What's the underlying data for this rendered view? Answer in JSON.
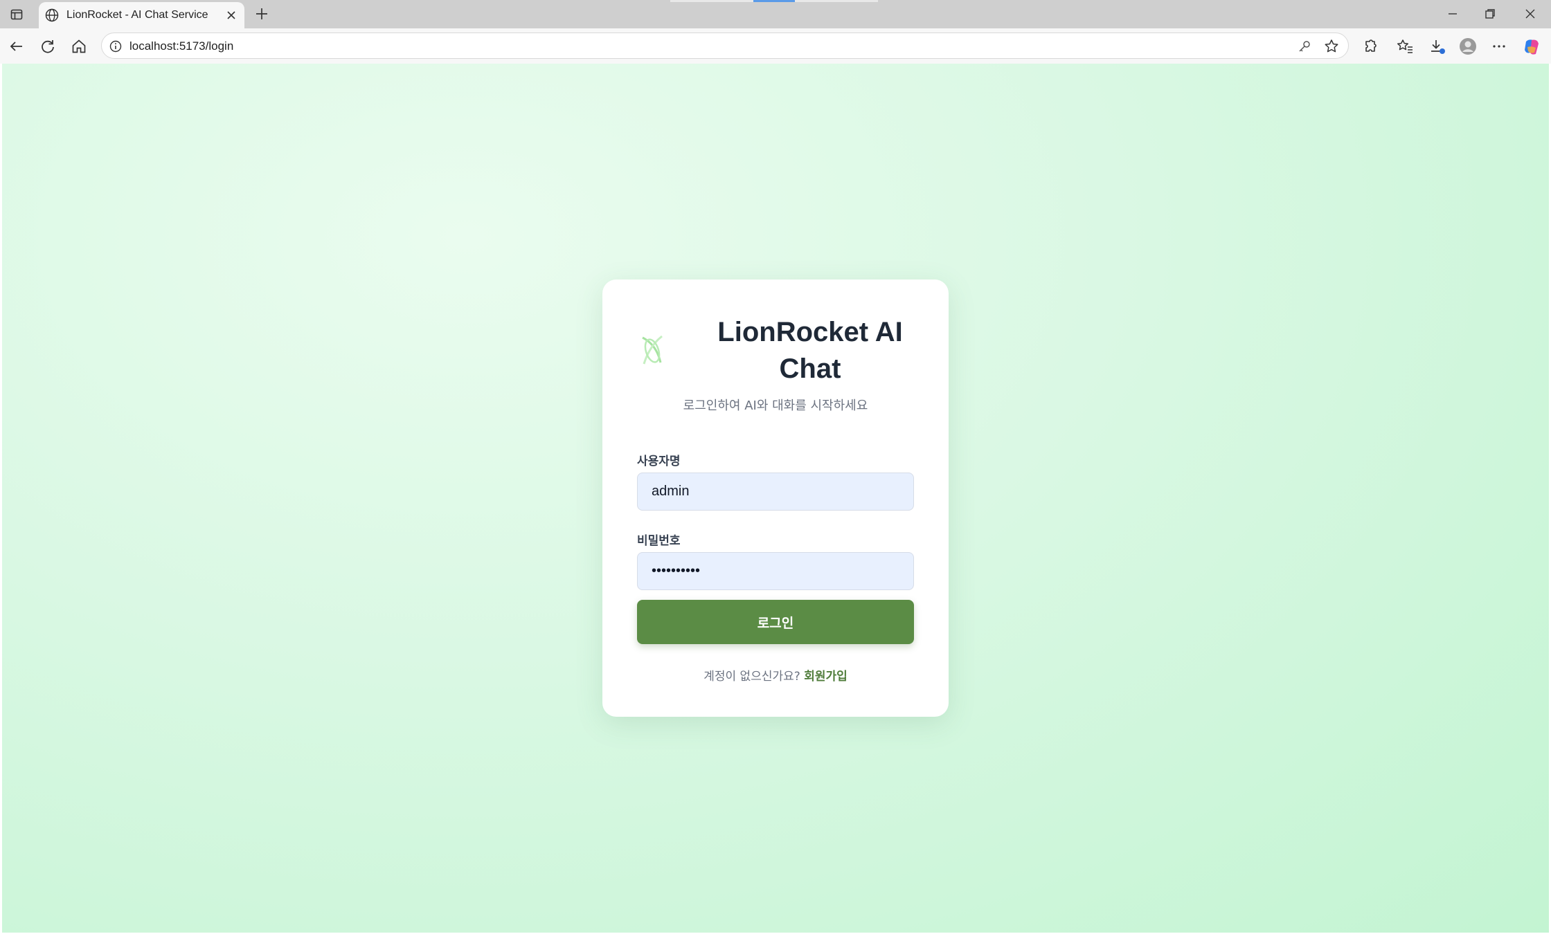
{
  "browser": {
    "tab_title": "LionRocket - AI Chat Service",
    "url": "localhost:5173/login"
  },
  "icons": {
    "tab_strip": "tab-strip-icon",
    "globe": "globe-icon",
    "close": "close-icon",
    "new_tab": "plus-icon",
    "minimize": "minimize-icon",
    "restore": "restore-icon",
    "window_close": "close-icon",
    "back": "back-arrow-icon",
    "reload": "reload-icon",
    "home": "home-icon",
    "site_info": "info-icon",
    "password_key": "key-icon",
    "favorite": "star-icon",
    "extensions": "puzzle-icon",
    "favorites": "favorites-icon",
    "downloads": "download-icon",
    "profile": "avatar",
    "more": "more-icon",
    "copilot": "copilot-icon",
    "brand_logo": "logo-icon"
  },
  "login": {
    "brand_title": "LionRocket AI Chat",
    "subtitle": "로그인하여 AI와 대화를 시작하세요",
    "username_label": "사용자명",
    "username_value": "admin",
    "password_label": "비밀번호",
    "password_mask": "••••••••••",
    "submit_label": "로그인",
    "footer_text": "계정이 없으신가요?",
    "signup_link": "회원가입"
  },
  "colors": {
    "accent": "#5b8c45",
    "link": "#4f7c3a",
    "input_bg": "#e8f0fe",
    "page_bg": "#d9f8e3"
  }
}
